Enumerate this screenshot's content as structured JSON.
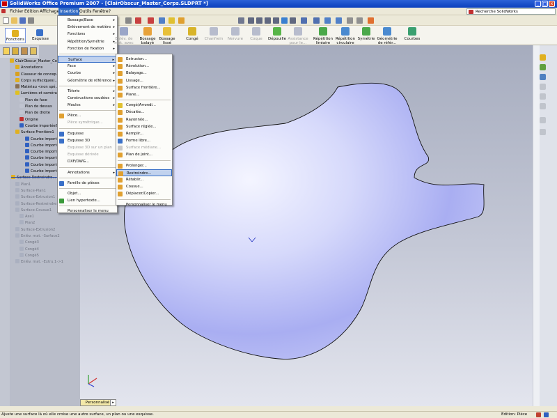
{
  "window": {
    "title": "SolidWorks Office Premium 2007 - [ClairObscur_Master_Corps.SLDPRT *]",
    "buttons": [
      "_",
      "□",
      "x"
    ]
  },
  "menubar": {
    "items": [
      "Fichier",
      "Edition",
      "Affichage",
      "Insertion",
      "Outils",
      "Fenêtre",
      "?"
    ],
    "active": "Insertion",
    "help_search": "Recherche SolidWorks"
  },
  "command_manager": {
    "tabs": [
      "Fonctions",
      "Esquisse"
    ],
    "tools": [
      {
        "label": "Enlèv. de\nmat. avec",
        "enabled": false,
        "color": "#9aa6c8"
      },
      {
        "label": "Bossage\nbalayé",
        "enabled": true,
        "color": "#e8a23a"
      },
      {
        "label": "Bossage\nlissé",
        "enabled": true,
        "color": "#e8c03a"
      },
      {
        "label": "Congé",
        "enabled": true,
        "color": "#d8b42a"
      },
      {
        "label": "Chanfrein",
        "enabled": false,
        "color": "#b7bccd"
      },
      {
        "label": "Nervure",
        "enabled": false,
        "color": "#b7bccd"
      },
      {
        "label": "Coque",
        "enabled": false,
        "color": "#b7bccd"
      },
      {
        "label": "Dépouille",
        "enabled": true,
        "color": "#58b548"
      },
      {
        "label": "Assistance\npour le...",
        "enabled": false,
        "color": "#b7bccd"
      },
      {
        "label": "Répétition\nlinéaire",
        "enabled": true,
        "color": "#4aa84a"
      },
      {
        "label": "Répétition\ncirculaire",
        "enabled": true,
        "color": "#4a8ad0"
      },
      {
        "label": "Symétrie",
        "enabled": true,
        "color": "#4aa84a"
      },
      {
        "label": "Géométrie\nde référ...",
        "enabled": true,
        "color": "#4a8ad0"
      },
      {
        "label": "Courbes",
        "enabled": true,
        "color": "#3aa070"
      }
    ]
  },
  "feature_tree": {
    "root": "ClairObscur_Master_Co...",
    "items": [
      {
        "label": "Annotations",
        "color": "#e0b020",
        "state": "normal"
      },
      {
        "label": "Classeur de concep...",
        "color": "#d8a020",
        "state": "normal"
      },
      {
        "label": "Corps surfaciques(...",
        "color": "#e0b020",
        "state": "normal"
      },
      {
        "label": "Matériau <non spé...",
        "color": "#8a7050",
        "state": "normal"
      },
      {
        "label": "Lumières et caméra...",
        "color": "#e0c020",
        "state": "normal"
      },
      {
        "label": "Plan de face",
        "color": "#c0c4d0",
        "state": "normal"
      },
      {
        "label": "Plan de dessus",
        "color": "#c0c4d0",
        "state": "normal"
      },
      {
        "label": "Plan de droite",
        "color": "#c0c4d0",
        "state": "normal"
      },
      {
        "label": "Origine",
        "color": "#c03030",
        "state": "normal"
      },
      {
        "label": "Courbe importée7",
        "color": "#3060c0",
        "state": "normal"
      },
      {
        "label": "Surface Frontière1",
        "color": "#e0b020",
        "state": "normal"
      },
      {
        "label": "Courbe importé...",
        "color": "#3060c0",
        "state": "normal"
      },
      {
        "label": "Courbe importé...",
        "color": "#3060c0",
        "state": "normal"
      },
      {
        "label": "Courbe importé...",
        "color": "#3060c0",
        "state": "normal"
      },
      {
        "label": "Courbe importé...",
        "color": "#3060c0",
        "state": "normal"
      },
      {
        "label": "Courbe importé...",
        "color": "#3060c0",
        "state": "normal"
      },
      {
        "label": "Courbe importé...",
        "color": "#3060c0",
        "state": "normal"
      },
      {
        "label": "Surface-Restreindre...",
        "color": "#e0b020",
        "state": "normal"
      },
      {
        "label": "Plan1",
        "color": "#aab0c0",
        "state": "dim"
      },
      {
        "label": "Surface-Plan1",
        "color": "#aab0c0",
        "state": "dim"
      },
      {
        "label": "Surface-Extrusion1",
        "color": "#aab0c0",
        "state": "dim"
      },
      {
        "label": "Surface-Restreindre...",
        "color": "#aab0c0",
        "state": "dim"
      },
      {
        "label": "Surface-Cousue1",
        "color": "#aab0c0",
        "state": "dim"
      },
      {
        "label": "Axe1",
        "color": "#aab0c0",
        "state": "dim"
      },
      {
        "label": "Plan2",
        "color": "#aab0c0",
        "state": "dim"
      },
      {
        "label": "Surface-Extrusion2",
        "color": "#aab0c0",
        "state": "dim"
      },
      {
        "label": "Enlèv. mat. -Surface2",
        "color": "#aab0c0",
        "state": "dim"
      },
      {
        "label": "Congé3",
        "color": "#aab0c0",
        "state": "dim"
      },
      {
        "label": "Congé4",
        "color": "#aab0c0",
        "state": "dim"
      },
      {
        "label": "Congé5",
        "color": "#aab0c0",
        "state": "dim"
      },
      {
        "label": "Enlèv. mat. -Extru.1->1",
        "color": "#aab0c0",
        "state": "dim"
      }
    ]
  },
  "insertion_menu": [
    {
      "label": "Bossage/Base",
      "submenu": true
    },
    {
      "label": "Enlèvement de matière",
      "submenu": true
    },
    {
      "label": "Fonctions",
      "submenu": true
    },
    {
      "label": "Répétition/Symétrie",
      "submenu": true
    },
    {
      "label": "Fonction de fixation",
      "submenu": true
    },
    {
      "sep": true
    },
    {
      "label": "Surface",
      "submenu": true,
      "highlight": true
    },
    {
      "label": "Face",
      "submenu": true
    },
    {
      "label": "Courbe",
      "submenu": true
    },
    {
      "label": "Géométrie de référence",
      "submenu": true
    },
    {
      "sep": true
    },
    {
      "label": "Tôlerie",
      "submenu": true
    },
    {
      "label": "Constructions soudées",
      "submenu": true
    },
    {
      "label": "Moules",
      "submenu": true
    },
    {
      "sep": true
    },
    {
      "label": "Pièce...",
      "icon": "#e0a030"
    },
    {
      "label": "Pièce symétrique...",
      "disabled": true
    },
    {
      "sep": true
    },
    {
      "label": "Esquisse",
      "icon": "#3a70c8"
    },
    {
      "label": "Esquisse 3D",
      "icon": "#3a70c8"
    },
    {
      "label": "Esquisse 3D sur un plan",
      "disabled": true
    },
    {
      "label": "Esquisse dérivée",
      "disabled": true
    },
    {
      "label": "DXF/DWG..."
    },
    {
      "sep": true
    },
    {
      "label": "Annotations",
      "submenu": true
    },
    {
      "sep": true
    },
    {
      "label": "Famille de pièces",
      "icon": "#3a70c8"
    },
    {
      "sep": true
    },
    {
      "label": "Objet..."
    },
    {
      "label": "Lien hypertexte...",
      "icon": "#3a9a3a"
    },
    {
      "sep": true
    },
    {
      "label": "Personnaliser le menu"
    }
  ],
  "surface_menu": [
    {
      "label": "Extrusion...",
      "icon": "#e0a030"
    },
    {
      "label": "Révolution...",
      "icon": "#e0a030"
    },
    {
      "label": "Balayage...",
      "icon": "#e0a030"
    },
    {
      "label": "Lissage...",
      "icon": "#e0a030"
    },
    {
      "label": "Surface frontière...",
      "icon": "#e0a030"
    },
    {
      "label": "Plane...",
      "icon": "#e0a030"
    },
    {
      "sep": true
    },
    {
      "label": "Congé/Arrondi...",
      "icon": "#e0c030"
    },
    {
      "label": "Décalée...",
      "icon": "#e0a030"
    },
    {
      "label": "Rayonnée...",
      "icon": "#e0a030"
    },
    {
      "label": "Surface réglée...",
      "icon": "#e0a030"
    },
    {
      "label": "Remplir...",
      "icon": "#e0a030"
    },
    {
      "label": "Forme libre...",
      "icon": "#3a70c8"
    },
    {
      "label": "Surface médiane...",
      "disabled": true,
      "icon": "#c8c8c8"
    },
    {
      "label": "Plan de joint...",
      "icon": "#e0a030"
    },
    {
      "sep": true
    },
    {
      "label": "Prolonger...",
      "icon": "#e0a030"
    },
    {
      "label": "Restreindre...",
      "icon": "#e0a030",
      "highlight": true
    },
    {
      "label": "Rétablir...",
      "icon": "#e0a030"
    },
    {
      "label": "Cousue...",
      "icon": "#e0a030"
    },
    {
      "label": "Déplacer/Copier...",
      "icon": "#e0a030"
    },
    {
      "sep": true
    },
    {
      "label": "Personnaliser le menu"
    }
  ],
  "bottom_tab": "Personnalisé",
  "statusbar": {
    "message": "Ajuste une surface là où elle croise une autre surface, un plan ou une esquisse.",
    "mode": "Edition: Pièce"
  },
  "colors": {
    "surface_fill": "#9ea4f0",
    "highlight": "#316ac5"
  }
}
